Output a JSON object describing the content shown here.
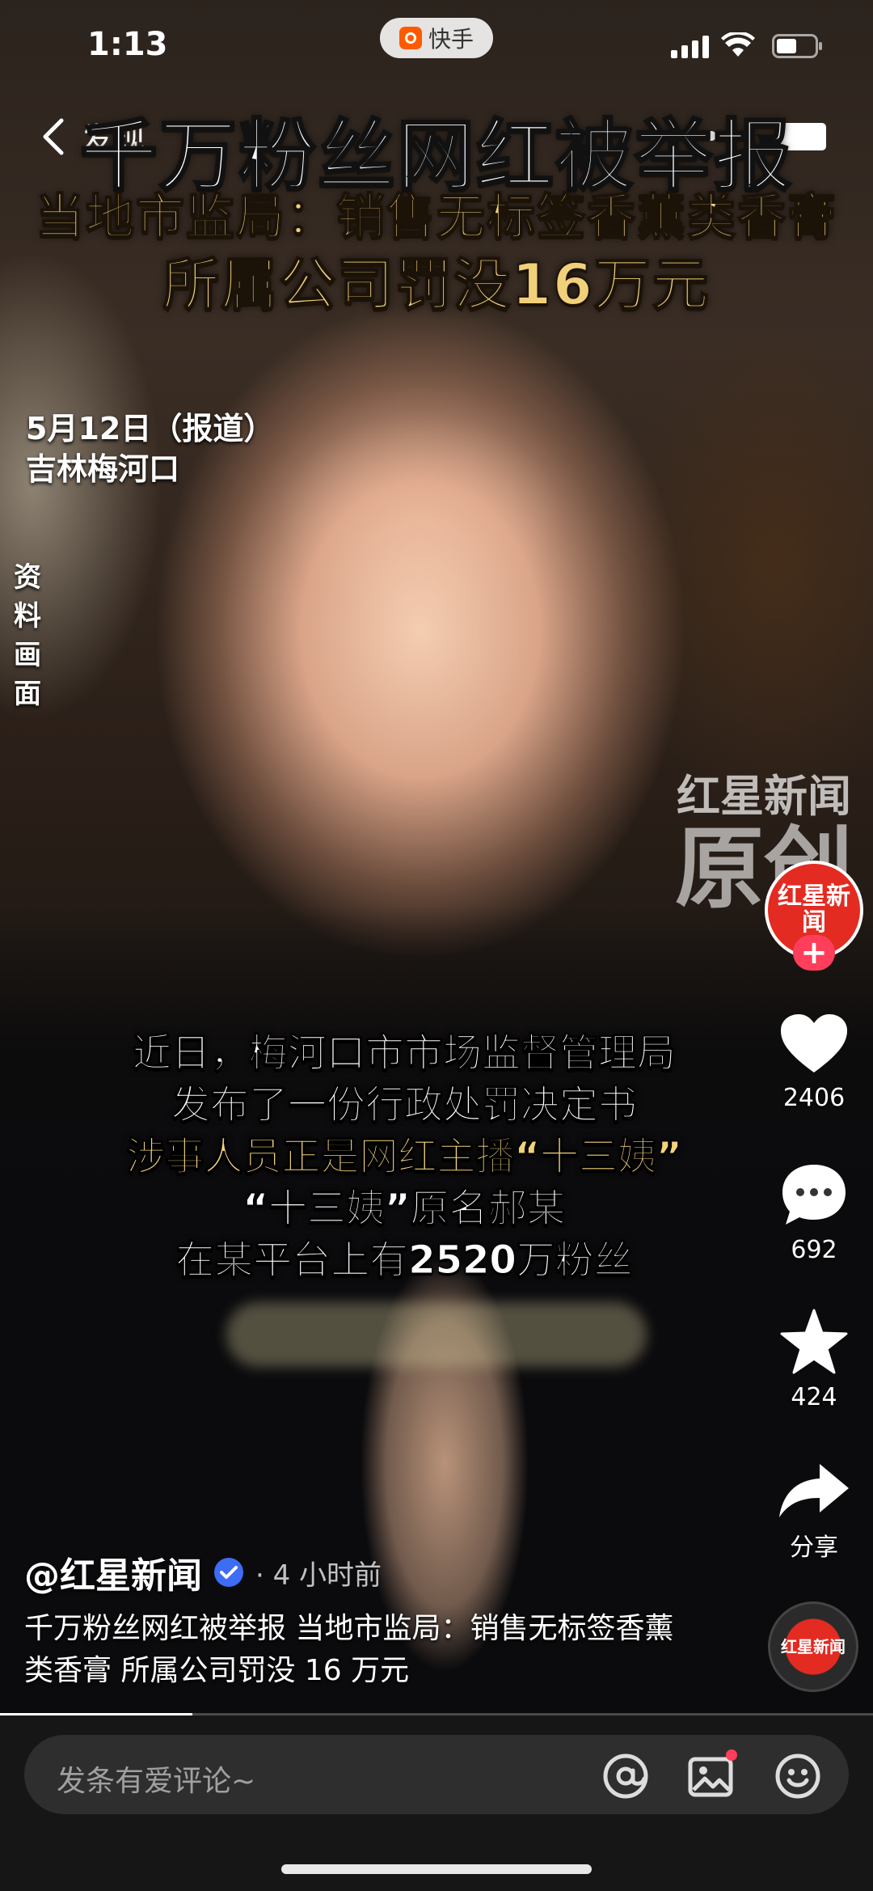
{
  "status_bar": {
    "time": "1:13",
    "app_name": "快手"
  },
  "nav": {
    "back_label": "发现"
  },
  "video": {
    "headline": "千万粉丝网红被举报",
    "subheadline_1": "当地市监局：销售无标签香薰类香膏",
    "subheadline_2": "所属公司罚没16万元",
    "date_line": "5月12日（报道）",
    "location_line": "吉林梅河口",
    "archive_label": "资料画面",
    "watermark_top": "红星新闻",
    "watermark_bottom": "原创",
    "subtitles": [
      "近日，梅河口市市场监督管理局",
      "发布了一份行政处罚决定书",
      "涉事人员正是网红主播“十三姨”",
      "“十三姨”原名郝某",
      "在某平台上有2520万粉丝"
    ]
  },
  "actions": {
    "avatar_text": "红星新闻",
    "follow": "+",
    "likes": "2406",
    "comments": "692",
    "favorites": "424",
    "share": "分享"
  },
  "post": {
    "author": "@红星新闻",
    "time": "· 4 小时前",
    "caption": "千万粉丝网红被举报 当地市监局：销售无标签香薰类香膏 所属公司罚没 16 万元",
    "music_label": "红星新闻",
    "progress": 0.22
  },
  "comment_bar": {
    "placeholder": "发条有爱评论~"
  },
  "colors": {
    "accent_red": "#ff3e5b",
    "headline_gold": "#f1d07a",
    "brand_red": "#e32b22"
  }
}
